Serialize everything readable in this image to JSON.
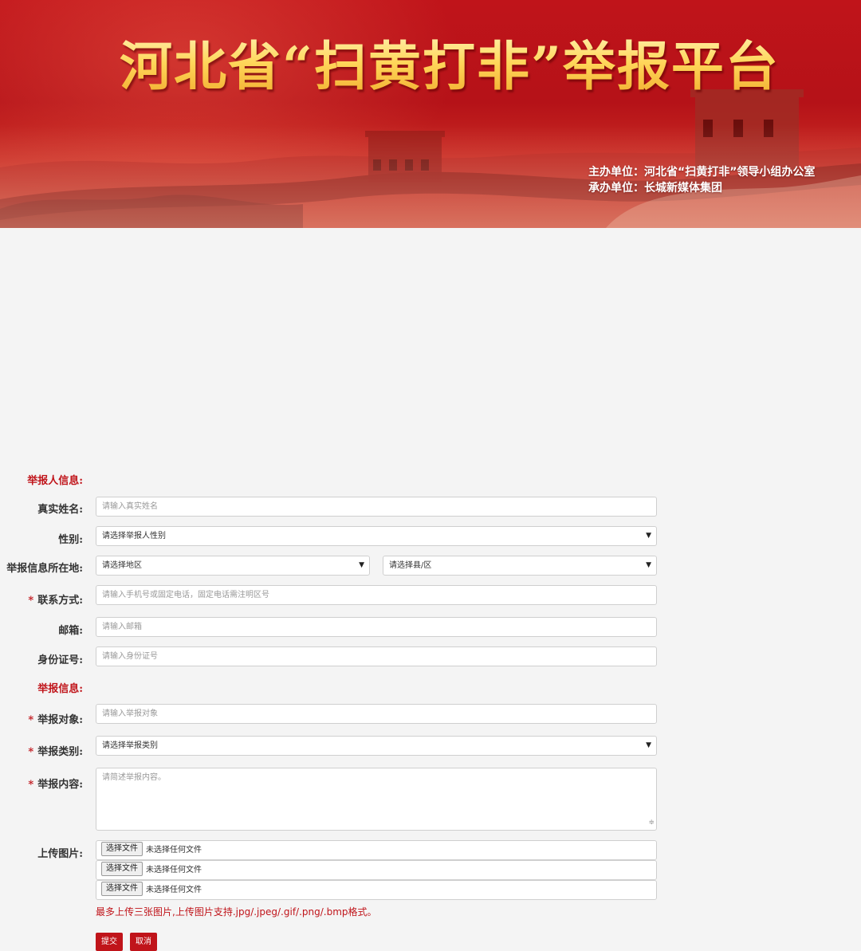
{
  "banner": {
    "title": "河北省“扫黄打非”举报平台",
    "sponsor": "主办单位：河北省“扫黄打非”领导小组办公室",
    "organizer": "承办单位：长城新媒体集团"
  },
  "sections": {
    "reporter": "举报人信息:",
    "report": "举报信息:"
  },
  "fields": {
    "name": {
      "label": "真实姓名:",
      "placeholder": "请输入真实姓名"
    },
    "gender": {
      "label": "性别:",
      "value": "请选择举报人性别"
    },
    "location": {
      "label": "举报信息所在地:",
      "region": "请选择地区",
      "county": "请选择县/区"
    },
    "contact": {
      "required": "*",
      "label": "联系方式:",
      "placeholder": "请输入手机号或固定电话，固定电话需注明区号"
    },
    "email": {
      "label": "邮箱:",
      "placeholder": "请输入邮箱"
    },
    "idcard": {
      "label": "身份证号:",
      "placeholder": "请输入身份证号"
    },
    "target": {
      "required": "*",
      "label": "举报对象:",
      "placeholder": "请输入举报对象"
    },
    "category": {
      "required": "*",
      "label": "举报类别:",
      "value": "请选择举报类别"
    },
    "content": {
      "required": "*",
      "label": "举报内容:",
      "placeholder": "请简述举报内容。"
    },
    "upload": {
      "label": "上传图片:",
      "choose": "选择文件",
      "no_file": "未选择任何文件",
      "hint": "最多上传三张图片,上传图片支持.jpg/.jpeg/.gif/.png/.bmp格式。"
    }
  },
  "actions": {
    "submit": "提交",
    "cancel": "取消"
  },
  "icons": {
    "select": "chevron-down-icon",
    "resize": "resize-grip-icon"
  },
  "colors": {
    "accent": "#c0141a",
    "title_gold": "#ffd65a",
    "background": "#f4f4f4"
  }
}
